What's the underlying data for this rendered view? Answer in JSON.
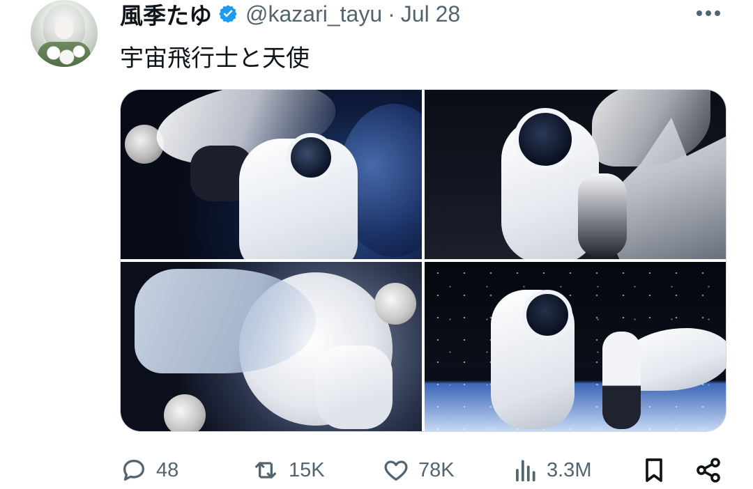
{
  "tweet": {
    "display_name": "風季たゆ",
    "handle": "@kazari_tayu",
    "separator": "·",
    "date": "Jul 28",
    "text": "宇宙飛行士と天使"
  },
  "icons": {
    "verified": "verified-badge-icon",
    "more": "more-dots-icon",
    "reply": "reply-icon",
    "retweet": "retweet-icon",
    "like": "heart-icon",
    "views": "views-chart-icon",
    "bookmark": "bookmark-icon",
    "share": "share-icon"
  },
  "colors": {
    "verified": "#1d9bf0",
    "text_primary": "#0f1419",
    "text_secondary": "#536471"
  },
  "stats": {
    "replies": "48",
    "retweets": "15K",
    "likes": "78K",
    "views": "3.3M"
  }
}
